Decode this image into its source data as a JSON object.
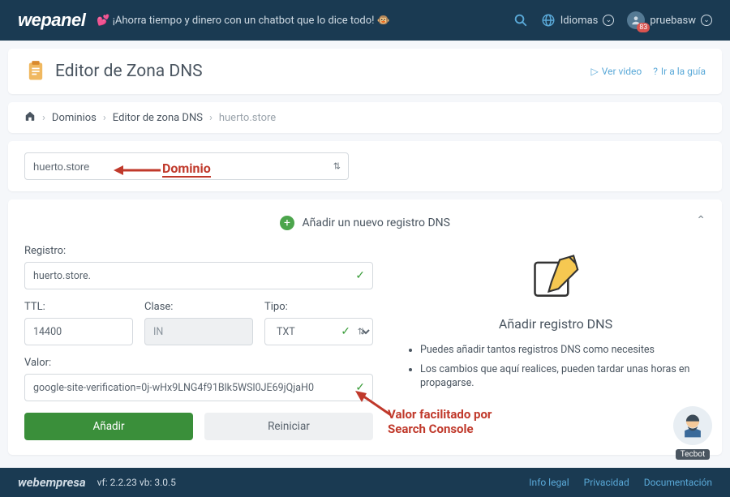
{
  "topbar": {
    "logo": "wepanel",
    "tagline": "💕 ¡Ahorra tiempo y dinero con un chatbot que lo dice todo! 🐵",
    "lang_label": "Idiomas",
    "user_name": "pruebasw",
    "user_badge": "83"
  },
  "page_header": {
    "title": "Editor de Zona DNS",
    "video_link": "Ver video",
    "guide_link": "Ir a la guía"
  },
  "breadcrumbs": {
    "items": [
      "Dominios",
      "Editor de zona DNS"
    ],
    "current": "huerto.store"
  },
  "domain_selector": {
    "value": "huerto.store"
  },
  "form": {
    "section_title": "Añadir un nuevo registro DNS",
    "registro_label": "Registro:",
    "registro_value": "huerto.store.",
    "ttl_label": "TTL:",
    "ttl_value": "14400",
    "clase_label": "Clase:",
    "clase_value": "IN",
    "tipo_label": "Tipo:",
    "tipo_value": "TXT",
    "valor_label": "Valor:",
    "valor_value": "google-site-verification=0j-wHx9LNG4f91Blk5WSl0JE69jQjaH0",
    "add_btn": "Añadir",
    "reset_btn": "Reiniciar"
  },
  "info_panel": {
    "title": "Añadir registro DNS",
    "tips": [
      "Puedes añadir tantos registros DNS como necesites",
      "Los cambios que aquí realices, pueden tardar unas horas en propagarse."
    ]
  },
  "annotations": {
    "dominio": "Dominio",
    "valor": "Valor facilitado por Search Console"
  },
  "tecbot": {
    "label": "Tecbot"
  },
  "footer": {
    "logo": "webempresa",
    "version": "vf: 2.2.23 vb: 3.0.5",
    "links": [
      "Info legal",
      "Privacidad",
      "Documentación"
    ]
  }
}
